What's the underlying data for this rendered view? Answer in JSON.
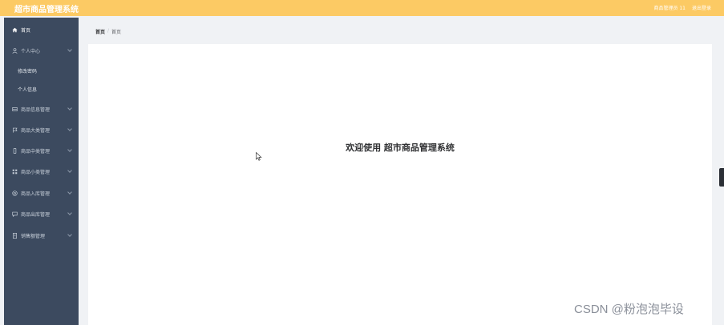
{
  "app": {
    "title": "超市商品管理系统",
    "user_label": "商品管理员 11",
    "logout_label": "退出登录",
    "accent_color": "#fcca64",
    "sidebar_color": "#3c4a5f"
  },
  "sidebar": {
    "items": [
      {
        "label": "首页",
        "icon": "home-icon"
      },
      {
        "label": "个人中心",
        "icon": "user-icon"
      },
      {
        "label": "修改密码",
        "icon": ""
      },
      {
        "label": "个人信息",
        "icon": ""
      },
      {
        "label": "商品信息管理",
        "icon": "list-icon"
      },
      {
        "label": "商品大类管理",
        "icon": "flag-icon"
      },
      {
        "label": "商品中类管理",
        "icon": "phone-icon"
      },
      {
        "label": "商品小类管理",
        "icon": "grid-icon"
      },
      {
        "label": "商品入库管理",
        "icon": "circle-icon"
      },
      {
        "label": "商品出库管理",
        "icon": "message-icon"
      },
      {
        "label": "销售额管理",
        "icon": "doc-icon"
      }
    ]
  },
  "breadcrumb": {
    "first": "首页",
    "separator": "/",
    "current": "首页"
  },
  "main": {
    "welcome": "欢迎使用 超市商品管理系统"
  },
  "watermark": "CSDN @粉泡泡毕设"
}
